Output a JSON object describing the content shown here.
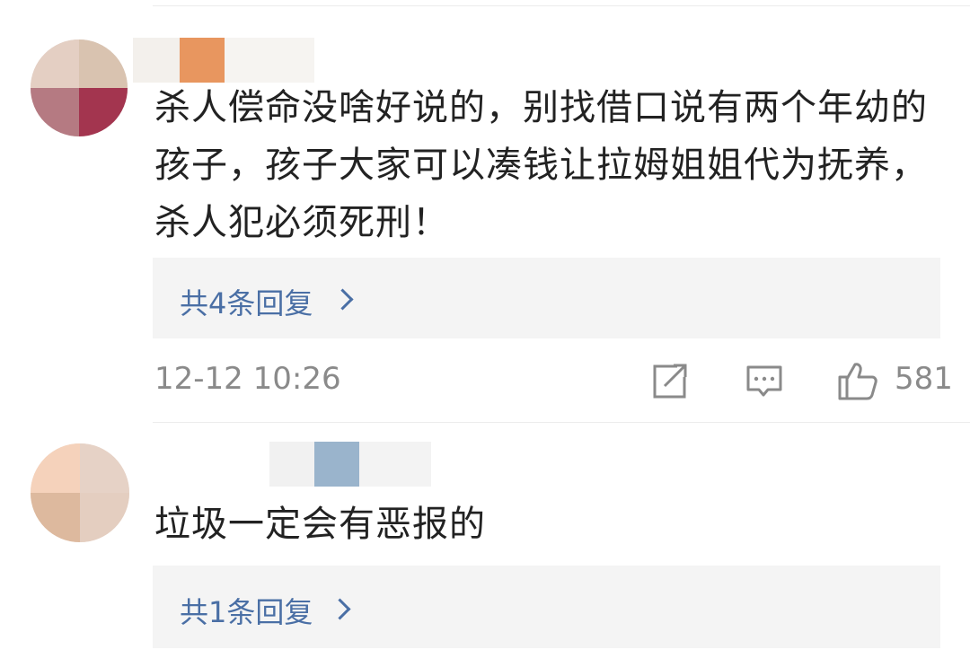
{
  "comments": [
    {
      "text_lines": [
        "杀人偿命没啥好说的，别找借口说有两个年幼的",
        "孩子，孩子大家可以凑钱让拉姆姐姐代为抚养，",
        "杀人犯必须死刑！"
      ],
      "reply_label": "共4条回复",
      "timestamp": "12-12 10:26",
      "like_count": "581",
      "avatar_colors": [
        "#e4cfc3",
        "#d9c3b0",
        "#b57a82",
        "#a3354f"
      ],
      "name_colors": [
        "#f3f0ec",
        "#e8965f",
        "#f6f4f1"
      ]
    },
    {
      "text_lines": [
        "垃圾一定会有恶报的"
      ],
      "reply_label": "共1条回复",
      "avatar_colors": [
        "#f5d2bb",
        "#e6d2c6",
        "#ddb99e",
        "#e4cec0"
      ],
      "name_colors": [
        "#f1f1f1",
        "#9ab4cc",
        "#f3f3f3"
      ]
    }
  ],
  "icons": {
    "share": "share-icon",
    "comment": "comment-icon",
    "like": "thumbs-up-icon"
  },
  "colors": {
    "reply_link": "#4a6fa5",
    "meta": "#8a8a8a",
    "text": "#222222",
    "reply_bg": "#f4f4f4"
  }
}
